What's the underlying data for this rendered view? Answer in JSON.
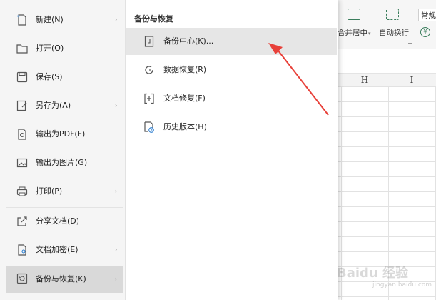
{
  "ribbon": {
    "merge_label": "合并居中",
    "autowrap_label": "自动换行",
    "format_value": "常规",
    "currency_symbol": "¥",
    "dropdown_glyph": "▾"
  },
  "columns": [
    "H",
    "I"
  ],
  "watermark": {
    "text": "Baidu 经验",
    "url": "jingyan.baidu.com"
  },
  "menu": {
    "items": [
      {
        "label": "新建(N)",
        "icon": "new-file-icon",
        "has_submenu": true
      },
      {
        "label": "打开(O)",
        "icon": "folder-icon",
        "has_submenu": false
      },
      {
        "label": "保存(S)",
        "icon": "save-icon",
        "has_submenu": false
      },
      {
        "label": "另存为(A)",
        "icon": "save-as-icon",
        "has_submenu": true
      },
      {
        "label": "输出为PDF(F)",
        "icon": "pdf-icon",
        "has_submenu": false
      },
      {
        "label": "输出为图片(G)",
        "icon": "image-icon",
        "has_submenu": false
      },
      {
        "label": "打印(P)",
        "icon": "printer-icon",
        "has_submenu": true
      },
      {
        "label": "分享文档(D)",
        "icon": "share-icon",
        "has_submenu": false
      },
      {
        "label": "文档加密(E)",
        "icon": "encrypt-icon",
        "has_submenu": true
      },
      {
        "label": "备份与恢复(K)",
        "icon": "backup-icon",
        "has_submenu": true,
        "active": true
      }
    ],
    "arrow_glyph": "›"
  },
  "submenu": {
    "title": "备份与恢复",
    "items": [
      {
        "label": "备份中心(K)...",
        "icon": "backup-center-icon",
        "hover": true
      },
      {
        "label": "数据恢复(R)",
        "icon": "data-recovery-icon"
      },
      {
        "label": "文档修复(F)",
        "icon": "document-repair-icon"
      },
      {
        "label": "历史版本(H)",
        "icon": "history-version-icon"
      }
    ]
  },
  "colors": {
    "accent_green": "#3a7d5c",
    "active_item_bg": "#d9d9d9",
    "hover_item_bg": "#e6e6e6",
    "annotation_arrow": "#e8413a"
  }
}
